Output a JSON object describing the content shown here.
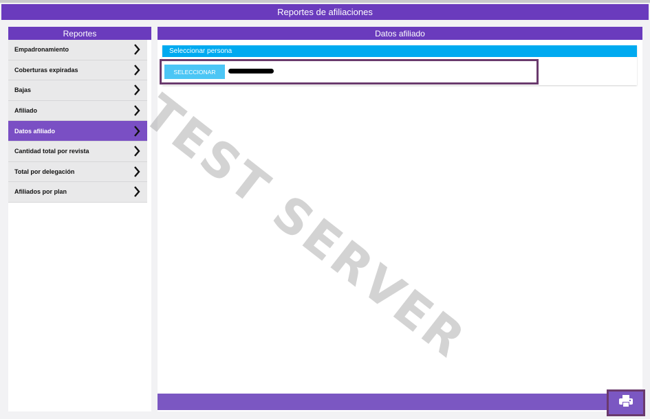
{
  "app": {
    "title": "Reportes de afiliaciones"
  },
  "sidebar": {
    "title": "Reportes",
    "items": [
      {
        "label": "Empadronamiento",
        "icon": "chevron-right-icon"
      },
      {
        "label": "Coberturas expiradas",
        "icon": "chevron-right-icon"
      },
      {
        "label": "Bajas",
        "icon": "chevron-right-icon"
      },
      {
        "label": "Afiliado",
        "icon": "chevron-right-icon"
      },
      {
        "label": "Datos afiliado",
        "icon": "chevron-right-icon",
        "active": true
      },
      {
        "label": "Cantidad total por revista",
        "icon": "chevron-right-icon"
      },
      {
        "label": "Total por delegación",
        "icon": "chevron-right-icon"
      },
      {
        "label": "Afiliados por plan",
        "icon": "chevron-right-icon"
      }
    ]
  },
  "main": {
    "title": "Datos afiliado",
    "panel": {
      "title": "Seleccionar persona",
      "button_label": "SELECCIONAR"
    }
  },
  "footer": {
    "print_icon": "printer-icon"
  },
  "watermark": "TEST SERVER",
  "colors": {
    "primary": "#6a3bbd",
    "active_item": "#7a4fc4",
    "panel_header": "#00aaf0",
    "button": "#4cc6f5",
    "highlight": "#6a3a6d"
  }
}
